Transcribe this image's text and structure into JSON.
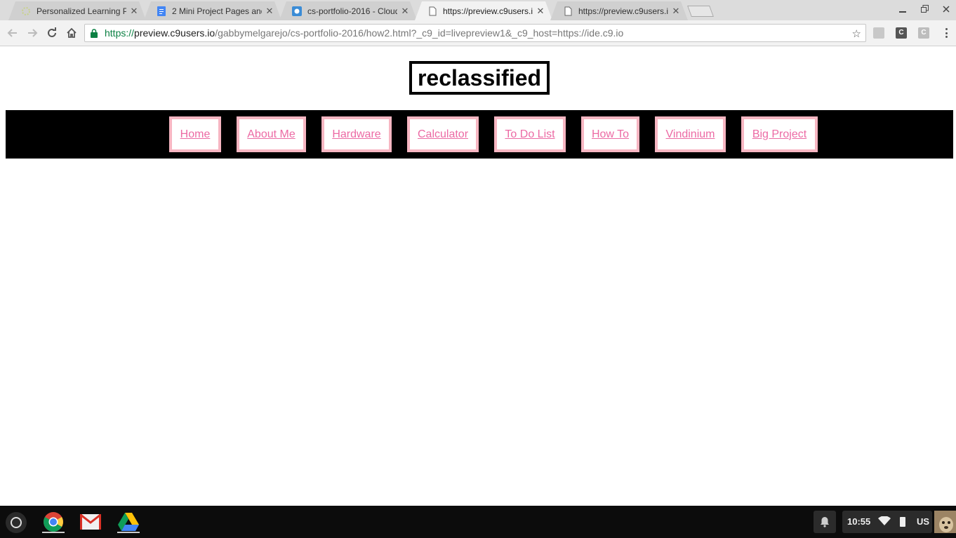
{
  "browser": {
    "tabs": [
      {
        "title": "Personalized Learning P",
        "icon": "pl-favicon-icon",
        "active": false
      },
      {
        "title": "2 Mini Project Pages and",
        "icon": "google-docs-icon",
        "active": false
      },
      {
        "title": "cs-portfolio-2016 - Cloud",
        "icon": "cloud9-icon",
        "active": false
      },
      {
        "title": "https://preview.c9users.i",
        "icon": "page-icon",
        "active": true
      },
      {
        "title": "https://preview.c9users.i",
        "icon": "page-icon",
        "active": false
      }
    ],
    "close_glyph": "✕",
    "url": {
      "scheme": "https://",
      "host": "preview.c9users.io",
      "path": "/gabbymelgarejo/cs-portfolio-2016/how2.html?_c9_id=livepreview1&_c9_host=https://ide.c9.io"
    },
    "extensions": [
      {
        "icon": "extension-gray-icon",
        "label": ""
      },
      {
        "icon": "extension-c-dark-icon",
        "label": "C"
      },
      {
        "icon": "extension-c-light-icon",
        "label": "C"
      }
    ]
  },
  "page": {
    "heading": "reclassified",
    "nav": [
      "Home",
      "About Me",
      "Hardware",
      "Calculator",
      "To Do List",
      "How To",
      "Vindinium",
      "Big Project"
    ],
    "colors": {
      "link": "#ec6aa4",
      "link_border": "#f7b6c2",
      "navbar_bg": "#000000"
    }
  },
  "shelf": {
    "apps": [
      "chrome-icon",
      "gmail-icon",
      "drive-icon"
    ],
    "clock": "10:55",
    "ime": "US"
  }
}
